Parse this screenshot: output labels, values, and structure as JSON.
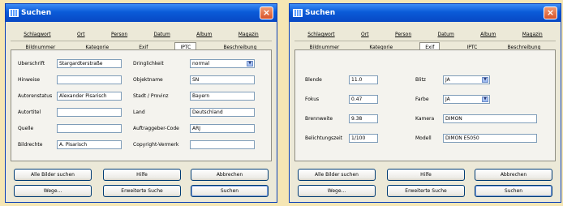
{
  "left_window": {
    "title": "Suchen",
    "tabs_row1": [
      "Schlagwort",
      "Ort",
      "Person",
      "Datum",
      "Album",
      "Magazin"
    ],
    "tabs_row2": [
      "Bildnummer",
      "Kategorie",
      "Exif",
      "IPTC",
      "Beschreibung"
    ],
    "active_tab": "IPTC",
    "fields_left": [
      {
        "label": "Überschrift",
        "value": "Stargardterstraße"
      },
      {
        "label": "Hinweise",
        "value": ""
      },
      {
        "label": "Autorenstatus",
        "value": "Alexander Pisarisch"
      },
      {
        "label": "Autortitel",
        "value": ""
      },
      {
        "label": "Quelle",
        "value": ""
      },
      {
        "label": "Bildrechte",
        "value": "A. Pisarisch"
      }
    ],
    "fields_right": [
      {
        "label": "Dringlichkeit",
        "value": "normal"
      },
      {
        "label": "Objektname",
        "value": "SN"
      },
      {
        "label": "Stadt / Provinz",
        "value": "Bayern"
      },
      {
        "label": "Land",
        "value": "Deutschland"
      },
      {
        "label": "Auftraggeber-Code",
        "value": "ARJ"
      },
      {
        "label": "Copyright-Vermerk",
        "value": ""
      }
    ],
    "buttons": {
      "all_images": "Alle Bilder suchen",
      "help": "Hilfe",
      "cancel": "Abbrechen",
      "wizard": "Wege...",
      "extended": "Erweiterte Suche",
      "search": "Suchen"
    }
  },
  "right_window": {
    "title": "Suchen",
    "tabs_row1": [
      "Schlagwort",
      "Ort",
      "Person",
      "Datum",
      "Album",
      "Magazin"
    ],
    "tabs_row2": [
      "Bildnummer",
      "Kategorie",
      "Exif",
      "IPTC",
      "Beschreibung"
    ],
    "active_tab": "Exif",
    "fields_left": [
      {
        "label": "Blende",
        "value": "11.0"
      },
      {
        "label": "Fokus",
        "value": "0.47"
      },
      {
        "label": "Brennweite",
        "value": "9.38"
      },
      {
        "label": "Belichtungszeit",
        "value": "1/100"
      }
    ],
    "fields_right": [
      {
        "label": "Blitz",
        "value": "JA",
        "combo": true
      },
      {
        "label": "Farbe",
        "value": "JA",
        "combo": true
      },
      {
        "label": "Kamera",
        "value": "DIMON",
        "combo": false
      },
      {
        "label": "Modell",
        "value": "DIMON E5050",
        "combo": false
      }
    ],
    "buttons": {
      "all_images": "Alle Bilder suchen",
      "help": "Hilfe",
      "cancel": "Abbrechen",
      "wizard": "Wege...",
      "extended": "Erweiterte Suche",
      "search": "Suchen"
    }
  },
  "icons": {
    "title_icon": "search-app-icon",
    "close": "close-icon",
    "dropdown": "dropdown-arrow-icon"
  }
}
